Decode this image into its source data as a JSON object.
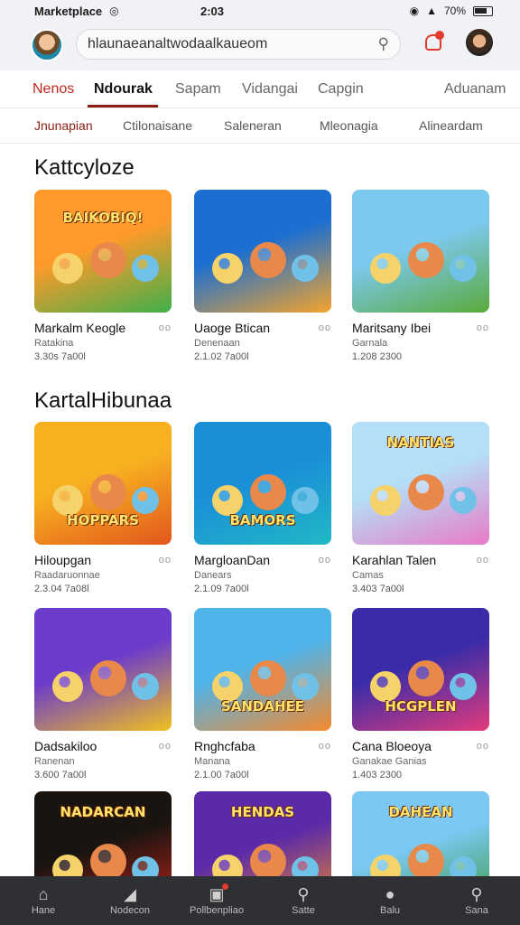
{
  "status": {
    "app": "Marketplace",
    "time": "2:03",
    "battery": "70%"
  },
  "header": {
    "search_query": "hlaunaeanaltwodaalkaueom"
  },
  "tabs": [
    "Nenos",
    "Ndourak",
    "Sapam",
    "Vidangai",
    "Capgin",
    "Aduanam"
  ],
  "subtabs": [
    "Jnunapian",
    "Ctilonaisane",
    "Saleneran",
    "Mleonagia",
    "Alineardam"
  ],
  "sections": [
    {
      "title": "Kattcyloze",
      "items": [
        {
          "banner": "BAIKOBIQ!",
          "name": "Markalm Keogle",
          "dev": "Ratakina",
          "stats": "3.30s 7a00l",
          "colors": [
            "#ff9a2a",
            "#3fb04a"
          ]
        },
        {
          "banner": "",
          "name": "Uaoge Btican",
          "dev": "Denenaan",
          "stats": "2.1.02 7a00l",
          "colors": [
            "#1c6fd1",
            "#f4a42c"
          ]
        },
        {
          "banner": "",
          "name": "Maritsany Ibei",
          "dev": "Garnala",
          "stats": "1.208 2300",
          "colors": [
            "#7cc9f0",
            "#5aaa3a"
          ]
        }
      ]
    },
    {
      "title": "KartalHibunaa",
      "items": [
        {
          "banner": "HOPPARS",
          "name": "Hiloupgan",
          "dev": "Raadaruonnae",
          "stats": "2.3.04 7a08l",
          "colors": [
            "#f7b020",
            "#e2561c"
          ]
        },
        {
          "banner": "BAMORS",
          "name": "MargloanDan",
          "dev": "Danears",
          "stats": "2.1.09 7a00l",
          "colors": [
            "#1b8ed8",
            "#20b8c6"
          ]
        },
        {
          "banner": "NANTIAS",
          "name": "Karahlan Talen",
          "dev": "Camas",
          "stats": "3.403 7a00l",
          "colors": [
            "#b4e0f7",
            "#e87ac8"
          ]
        }
      ]
    },
    {
      "title": "",
      "items": [
        {
          "banner": "",
          "name": "Dadsakiloo",
          "dev": "Ranenan",
          "stats": "3.600 7a00l",
          "colors": [
            "#6b3bcc",
            "#f0c020"
          ]
        },
        {
          "banner": "SANDAHEE",
          "name": "Rnghcfaba",
          "dev": "Manana",
          "stats": "2.1.00 7a00l",
          "colors": [
            "#4fb4ea",
            "#f58a2e"
          ]
        },
        {
          "banner": "HCGPLEN",
          "name": "Cana Bloeoya",
          "dev": "Ganakae Ganias",
          "stats": "1.403 2300",
          "colors": [
            "#3a2ca8",
            "#e23b7d"
          ]
        }
      ]
    },
    {
      "title": "",
      "items": [
        {
          "banner": "NADARCAN",
          "name": "",
          "dev": "",
          "stats": "",
          "colors": [
            "#1a1410",
            "#c02418"
          ]
        },
        {
          "banner": "HENDAS",
          "name": "",
          "dev": "",
          "stats": "",
          "colors": [
            "#5b2aa8",
            "#f08a2a"
          ]
        },
        {
          "banner": "DAHEAN",
          "name": "",
          "dev": "",
          "stats": "",
          "colors": [
            "#7bc8f4",
            "#3a9a3a"
          ]
        }
      ]
    }
  ],
  "bottom_nav": [
    {
      "label": "Hane",
      "icon": "home-icon"
    },
    {
      "label": "Nodecon",
      "icon": "tag-icon"
    },
    {
      "label": "Pollbenpliao",
      "icon": "store-icon"
    },
    {
      "label": "Satte",
      "icon": "search-icon"
    },
    {
      "label": "Balu",
      "icon": "games-icon"
    },
    {
      "label": "Sana",
      "icon": "search-icon"
    }
  ]
}
